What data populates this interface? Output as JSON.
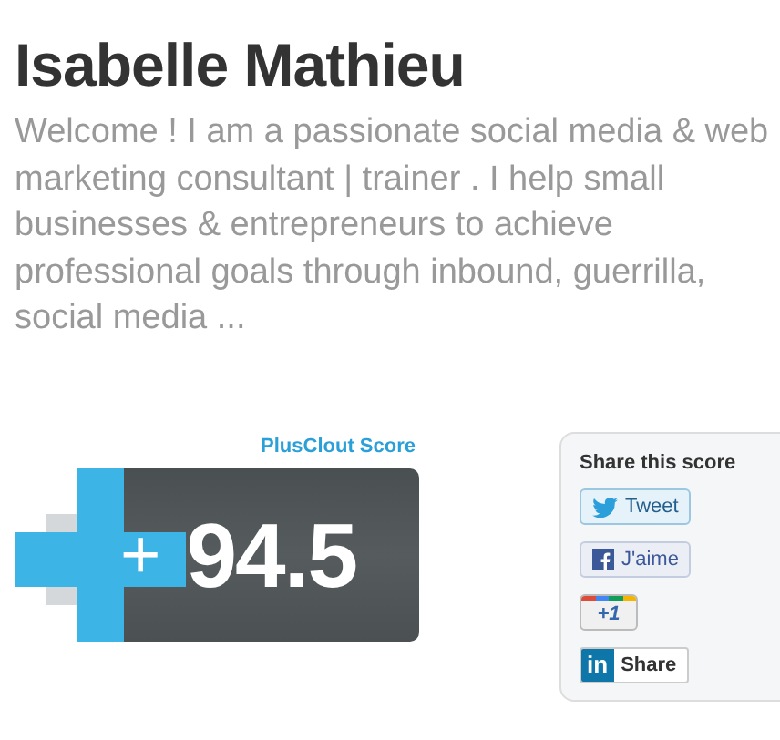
{
  "profile": {
    "name": "Isabelle Mathieu",
    "bio": "Welcome ! I am a passionate social media & web marketing consultant | trainer . I help small businesses & entrepreneurs to achieve professional goals through inbound, guerrilla, social media ..."
  },
  "score": {
    "label": "PlusClout Score",
    "plus": "+",
    "value": "94.5"
  },
  "share": {
    "title": "Share this score",
    "buttons": [
      {
        "kind": "twitter",
        "label": "Tweet"
      },
      {
        "kind": "facebook",
        "label": "J'aime"
      },
      {
        "kind": "google",
        "label": "+1"
      },
      {
        "kind": "linkedin",
        "label": "Share",
        "badge": "in"
      }
    ]
  }
}
